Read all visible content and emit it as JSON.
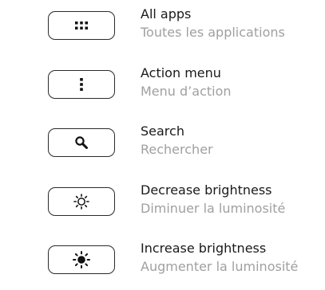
{
  "shortcuts": [
    {
      "key_icon": "all-apps-icon",
      "label_en": "All apps",
      "label_fr": "Toutes les applications"
    },
    {
      "key_icon": "action-menu-icon",
      "label_en": "Action menu",
      "label_fr": "Menu d’action"
    },
    {
      "key_icon": "search-icon",
      "label_en": "Search",
      "label_fr": "Rechercher"
    },
    {
      "key_icon": "brightness-down-icon",
      "label_en": "Decrease brightness",
      "label_fr": "Diminuer la luminosité"
    },
    {
      "key_icon": "brightness-up-icon",
      "label_en": "Increase brightness",
      "label_fr": "Augmenter la luminosité"
    }
  ],
  "colors": {
    "primary_text": "#1a1a1a",
    "secondary_text": "#a0a0a0",
    "key_border": "#2a2a2a"
  }
}
